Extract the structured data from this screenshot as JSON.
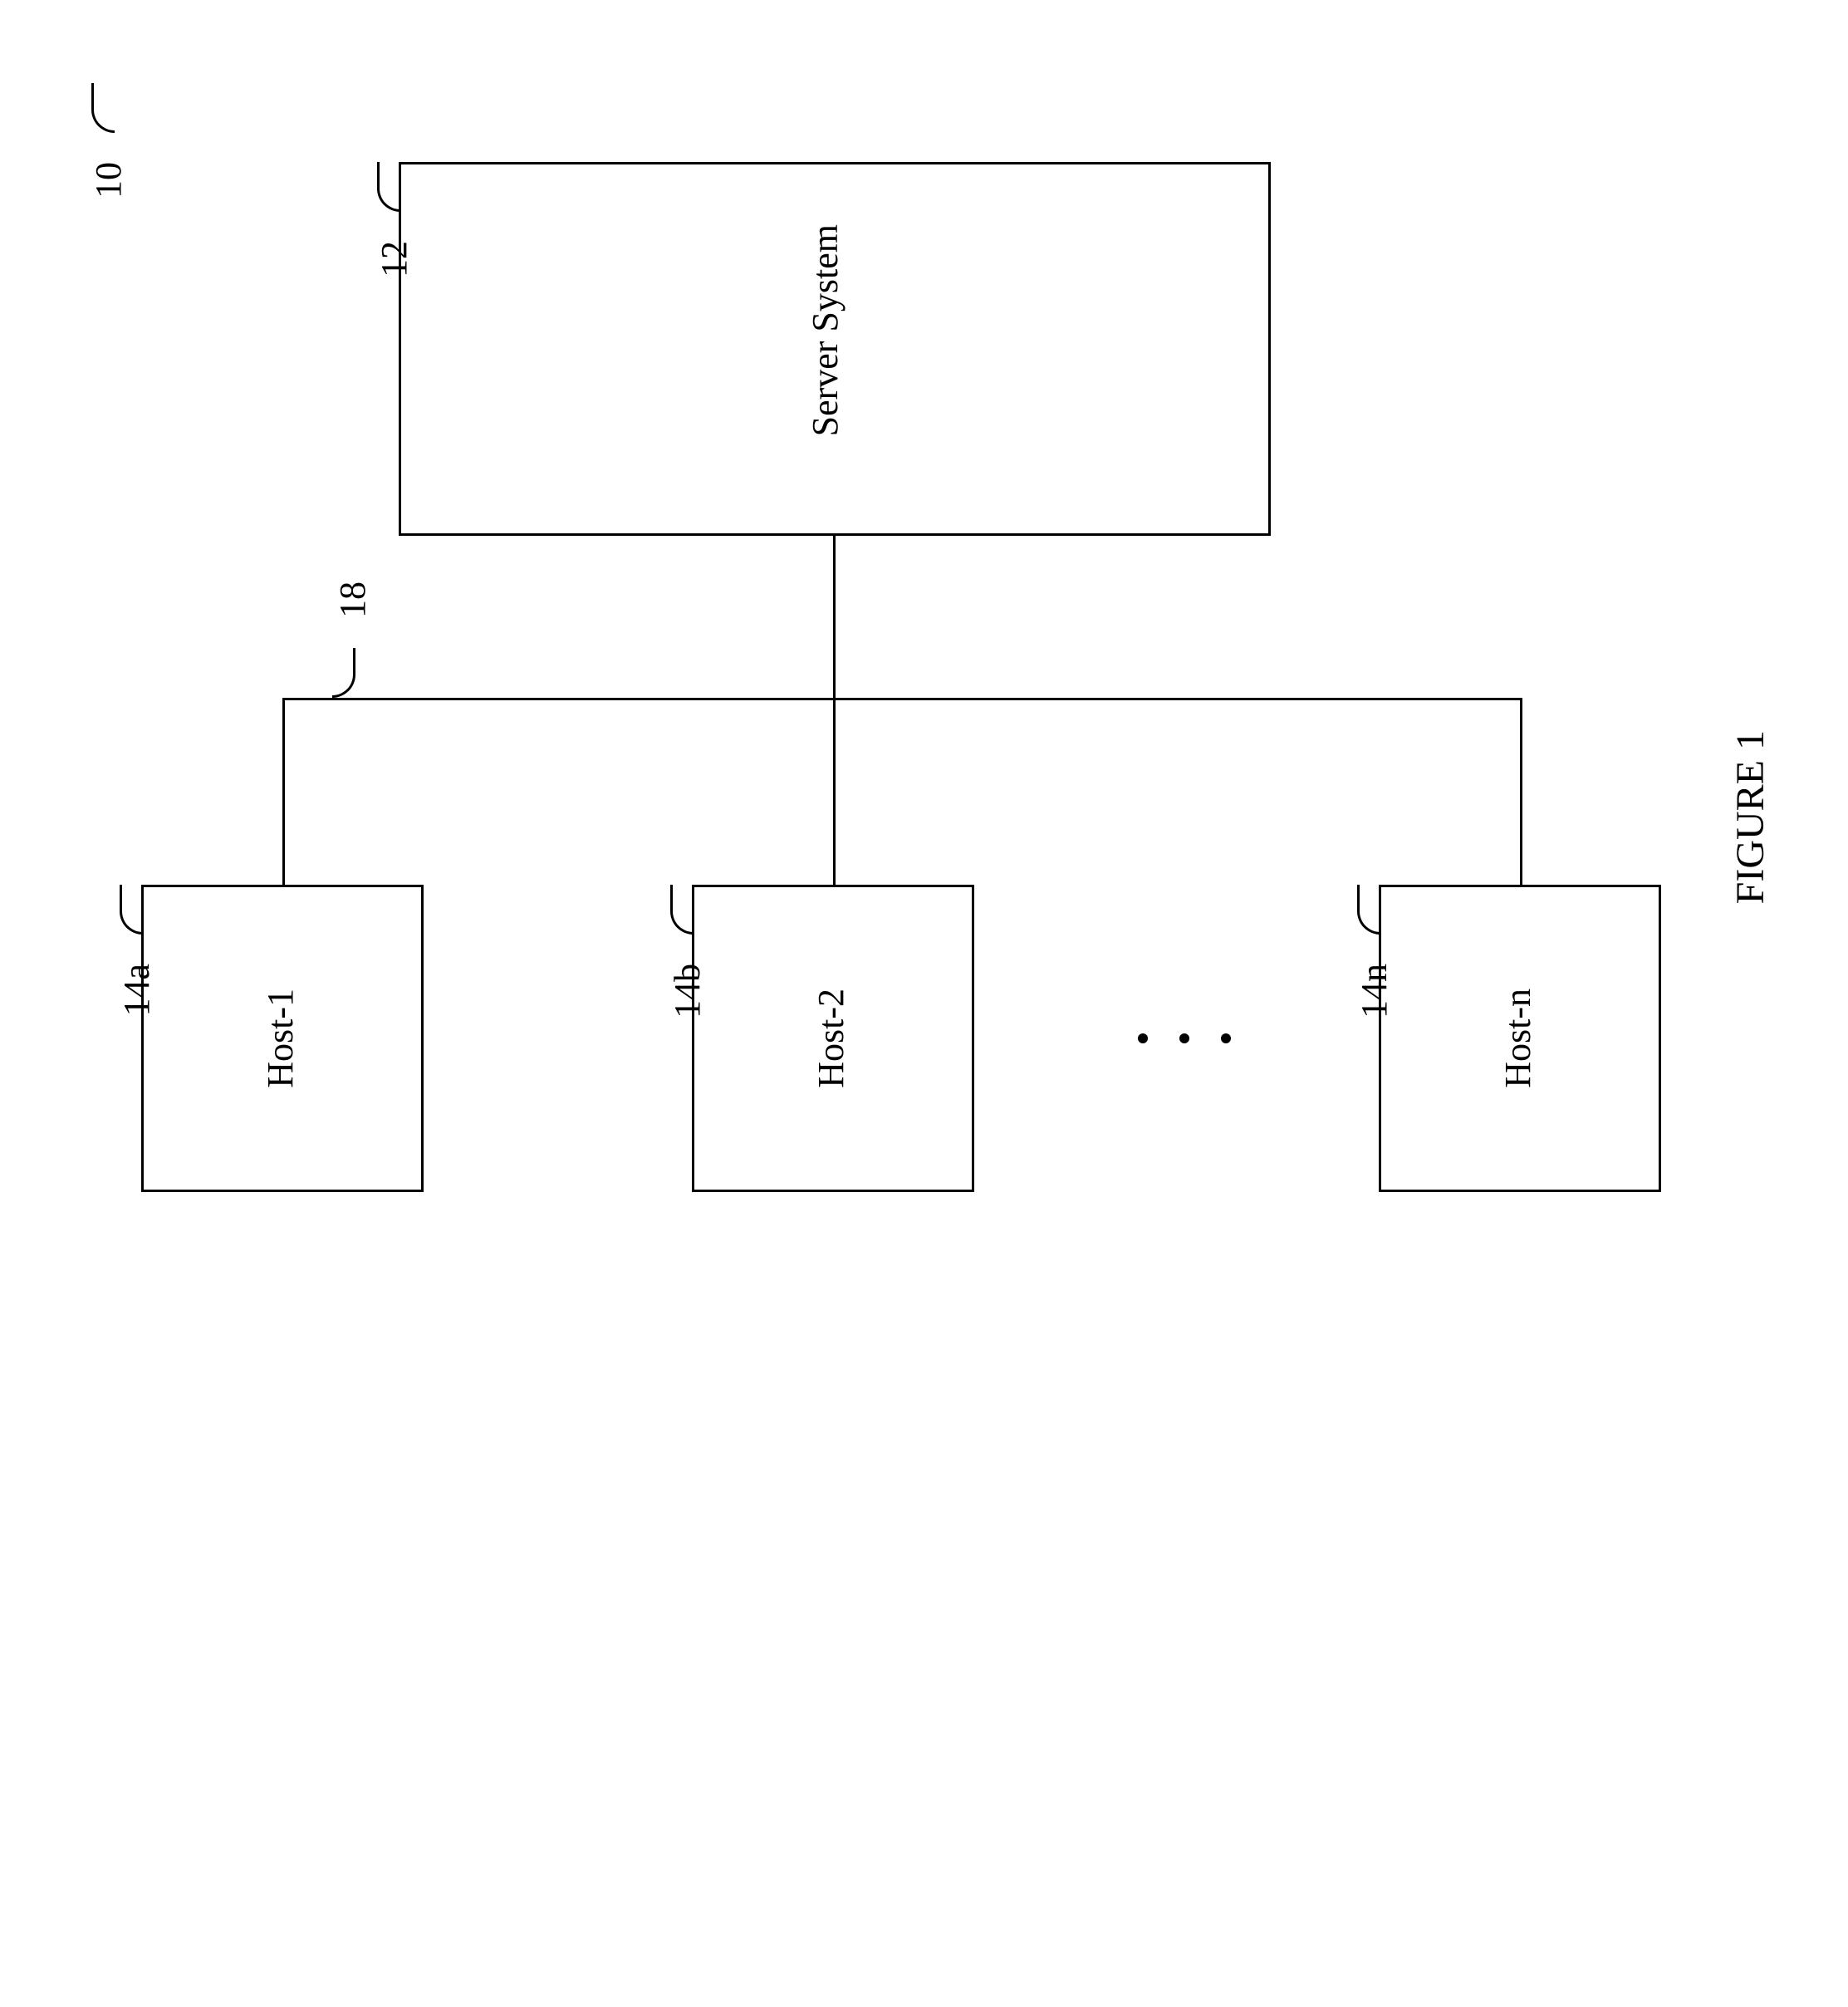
{
  "figure": {
    "caption": "FIGURE 1",
    "system_ref": "10",
    "server": {
      "label": "Server System",
      "ref": "12"
    },
    "bus_ref": "18",
    "hosts": [
      {
        "label": "Host-1",
        "ref": "14a"
      },
      {
        "label": "Host-2",
        "ref": "14b"
      },
      {
        "label": "Host-n",
        "ref": "14n"
      }
    ],
    "ellipsis": "•  •  •"
  }
}
